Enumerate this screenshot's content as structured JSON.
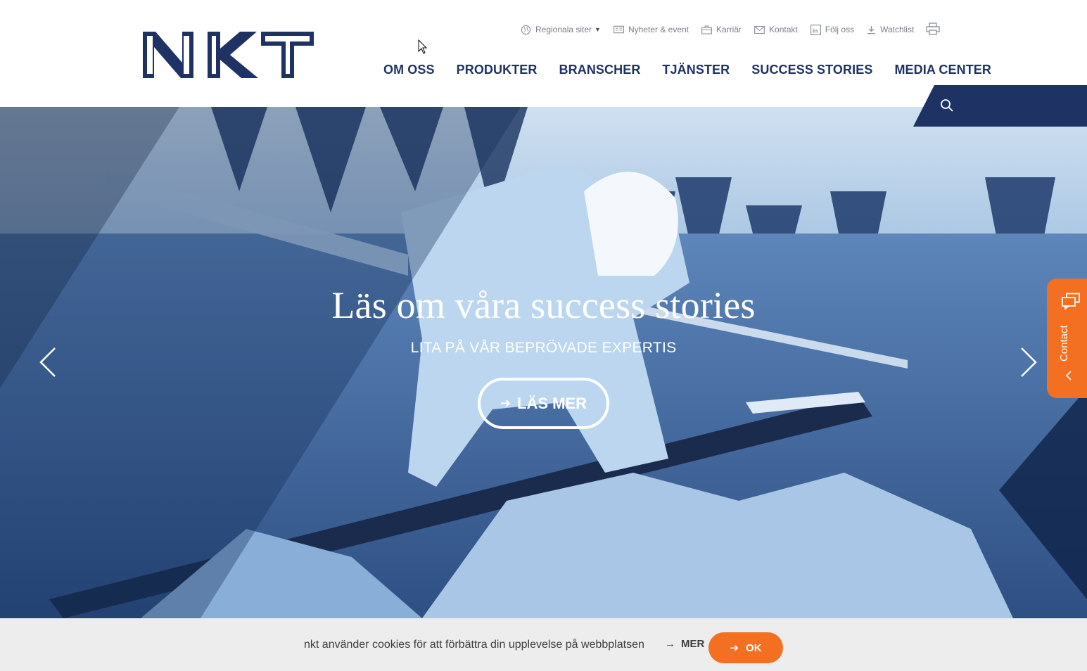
{
  "brand": {
    "name": "NKT",
    "primary_color": "#1e3264",
    "accent_color": "#f36f21"
  },
  "utility": {
    "items": [
      {
        "label": "Regionala siter",
        "icon": "globe-icon",
        "has_dropdown": true
      },
      {
        "label": "Nyheter & event",
        "icon": "newspaper-icon"
      },
      {
        "label": "Karriär",
        "icon": "briefcase-icon"
      },
      {
        "label": "Kontakt",
        "icon": "envelope-icon"
      },
      {
        "label": "Följ oss",
        "icon": "linkedin-icon"
      },
      {
        "label": "Watchlist",
        "icon": "download-icon"
      }
    ],
    "print_icon": "printer-icon"
  },
  "nav": {
    "items": [
      "OM OSS",
      "PRODUKTER",
      "BRANSCHER",
      "TJÄNSTER",
      "SUCCESS STORIES",
      "MEDIA CENTER"
    ]
  },
  "search": {
    "icon": "search-icon"
  },
  "hero": {
    "title": "Läs om våra success stories",
    "subtitle": "LITA PÅ VÅR BEPRÖVADE EXPERTIS",
    "cta_label": "LÄS MER",
    "prev_icon": "chevron-left-icon",
    "next_icon": "chevron-right-icon"
  },
  "contact_tab": {
    "label": "Contact",
    "icon": "chat-icon"
  },
  "cookie": {
    "text": "nkt använder cookies för att förbättra din upplevelse på webbplatsen",
    "more_label": "MER",
    "ok_label": "OK"
  }
}
